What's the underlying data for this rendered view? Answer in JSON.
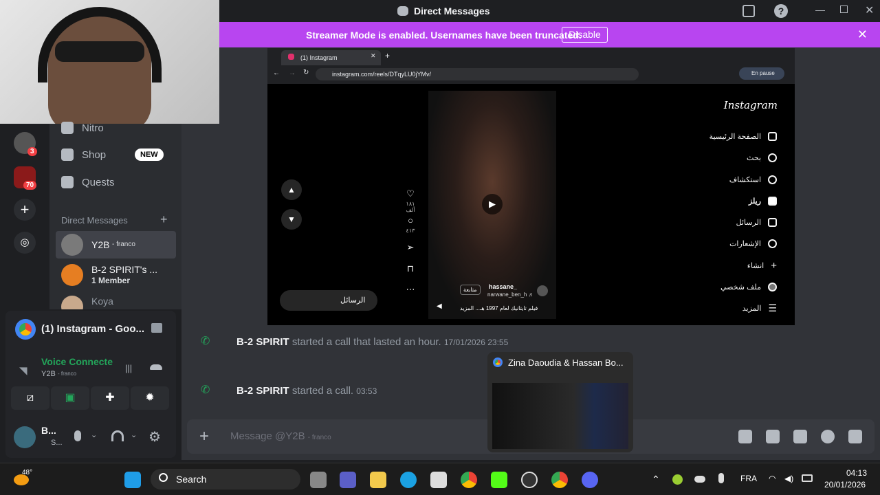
{
  "window": {
    "title": "Direct Messages"
  },
  "banner": {
    "text": "Streamer Mode is enabled. Usernames have been truncated.",
    "button": "Disable"
  },
  "guilds": [
    {
      "badge": "3"
    },
    {
      "badge": "70"
    }
  ],
  "sidebar": {
    "nav": [
      {
        "label": "Nitro",
        "icon": "nitro-icon"
      },
      {
        "label": "Shop",
        "icon": "shop-icon",
        "badge": "NEW"
      },
      {
        "label": "Quests",
        "icon": "quests-icon"
      }
    ],
    "dm_header": "Direct Messages",
    "dms": [
      {
        "name": "Y2B",
        "suffix": "- franco",
        "selected": true
      },
      {
        "name": "B-2 SPIRIT's ...",
        "sub": "1 Member"
      },
      {
        "name": "Koya"
      }
    ]
  },
  "panel": {
    "stream_title": "(1) Instagram - Goo...",
    "voice_status": "Voice Connecte",
    "voice_channel": "Y2B",
    "voice_suffix": "- franco",
    "user_name": "B...",
    "user_status": "S..."
  },
  "stream": {
    "tab_title": "(1) Instagram",
    "url": "instagram.com/reels/DTqyLU0jYMv/",
    "paused": "En pause",
    "logo": "Instagram",
    "nav": [
      "الصفحة الرئيسية",
      "بحث",
      "استكشاف",
      "ريلز",
      "الرسائل",
      "الإشعارات",
      "انشاء",
      "ملف شخصي",
      "المزيد"
    ],
    "likes": "١٨١ ألف",
    "comments": "٤١٣",
    "reel_user": "hassane_",
    "reel_audio": "narwane_ben_h ♬",
    "follow": "متابعة",
    "caption": "فيلم تايتانيك لعام 1997 هـ... المزيد",
    "messages_pill": "الرسائل"
  },
  "calls": [
    {
      "user": "B-2 SPIRIT",
      "text": "started a call that lasted an hour.",
      "time": "17/01/2026 23:55"
    },
    {
      "user": "B-2 SPIRIT",
      "text": "started a call.",
      "time": "03:53"
    }
  ],
  "composer": {
    "placeholder": "Message @Y2B",
    "suffix": "- franco"
  },
  "thumbnail": {
    "title": "Zina Daoudia & Hassan Bo..."
  },
  "taskbar": {
    "weather": "48°",
    "search": "Search",
    "lang": "FRA",
    "time": "04:13",
    "date": "20/01/2026"
  }
}
